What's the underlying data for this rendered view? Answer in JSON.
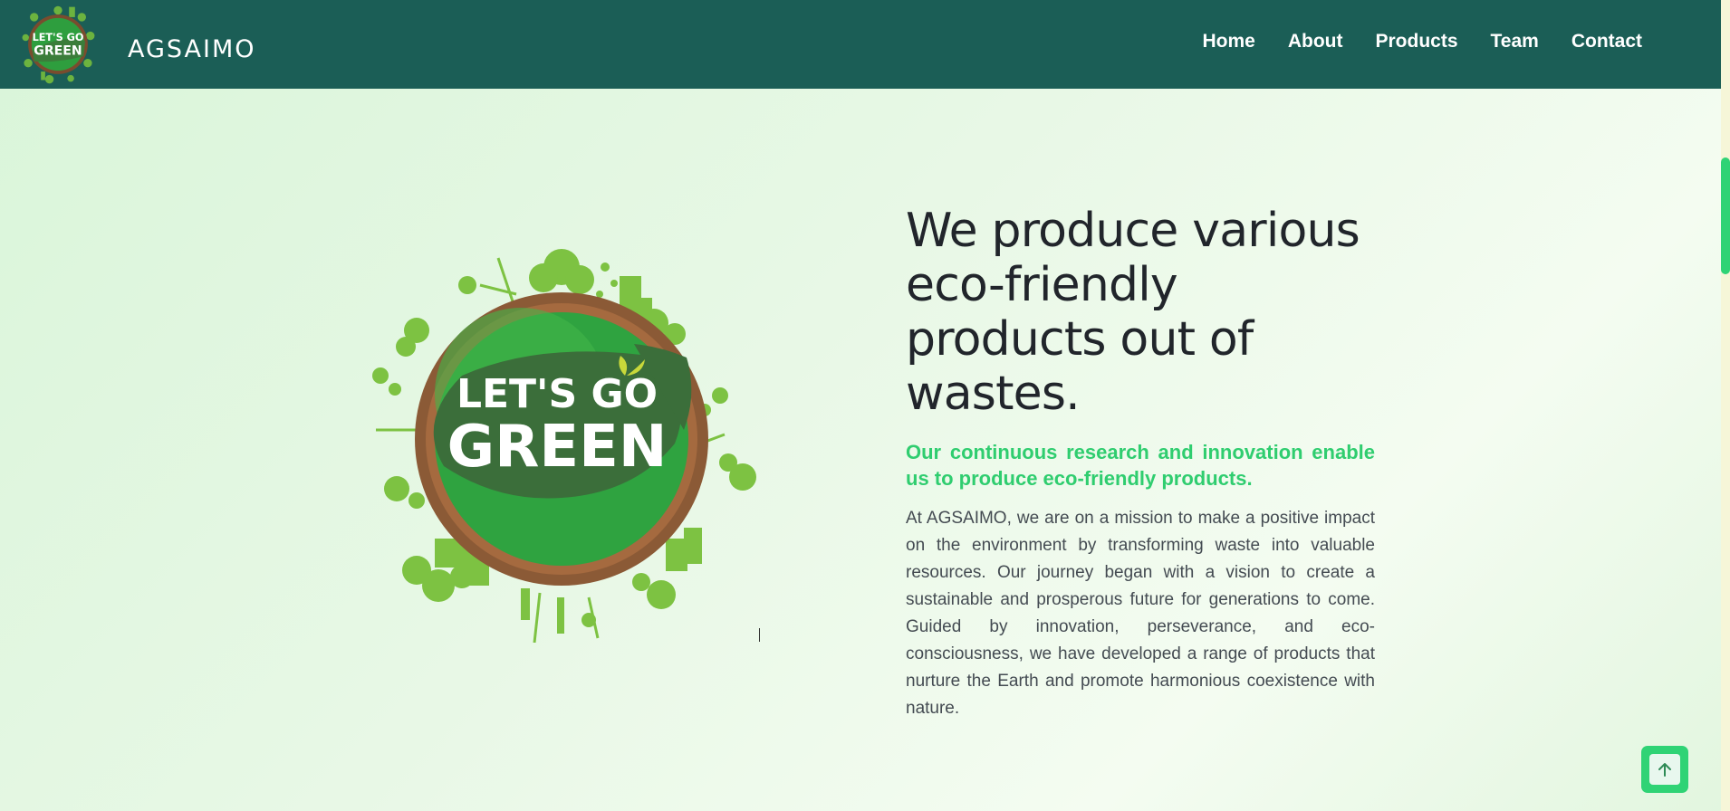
{
  "header": {
    "brand_name": "AGSAIMO",
    "logo_text_top": "LET'S GO",
    "logo_text_bottom": "GREEN",
    "nav": [
      {
        "label": "Home"
      },
      {
        "label": "About"
      },
      {
        "label": "Products"
      },
      {
        "label": "Team"
      },
      {
        "label": "Contact"
      }
    ]
  },
  "hero": {
    "image_text_top": "LET'S GO",
    "image_text_bottom": "GREEN",
    "title": "We produce various eco-friendly products out of wastes.",
    "subtitle": "Our continuous research and innovation enable us to produce eco-friendly products.",
    "body": "At AGSAIMO, we are on a mission to make a positive impact on the environment by transforming waste into valuable resources. Our journey began with a vision to create a sustainable and prosperous future for generations to come. Guided by innovation, perseverance, and eco-consciousness, we have developed a range of products that nurture the Earth and promote harmonious coexistence with nature."
  },
  "controls": {
    "back_to_top_icon": "arrow-up-icon"
  },
  "colors": {
    "header_bg": "#1b5e56",
    "accent_green": "#2fcd6f",
    "text_dark": "#21252b",
    "text_body": "#444b52"
  }
}
